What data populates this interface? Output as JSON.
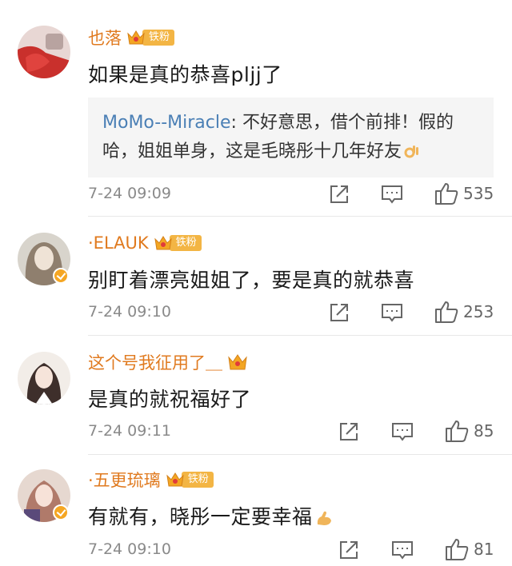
{
  "comments": [
    {
      "username": "也落",
      "badge": "铁粉",
      "text": "如果是真的恭喜pljj了",
      "quote": {
        "author": "MoMo--Miracle",
        "separator": ": ",
        "line1": "不好意思，借个前排！假的",
        "line2": "哈，姐姐单身，这是毛晓彤十几年好友",
        "emoji": "ok-hand-emoji"
      },
      "time": "7-24 09:09",
      "likes": "535"
    },
    {
      "username": "·ELAUK",
      "badge": "铁粉",
      "text": "别盯着漂亮姐姐了，要是真的就恭喜",
      "time": "7-24 09:10",
      "likes": "253"
    },
    {
      "username": "这个号我征用了＿",
      "badge": "",
      "text": "是真的就祝福好了",
      "time": "7-24 09:11",
      "likes": "85"
    },
    {
      "username": "·五更琉璃",
      "badge": "铁粉",
      "text": "有就有，晓彤一定要幸福",
      "emoji": "flexed-biceps-emoji",
      "time": "7-24 09:10",
      "likes": "81"
    }
  ],
  "colors": {
    "username": "#e07a1f",
    "quote_author": "#4a7fb5",
    "badge": "#f3b544",
    "verified": "#f5a623"
  },
  "icons": [
    "share-icon",
    "reply-icon",
    "like-icon",
    "crown-icon",
    "verified-badge-icon"
  ]
}
